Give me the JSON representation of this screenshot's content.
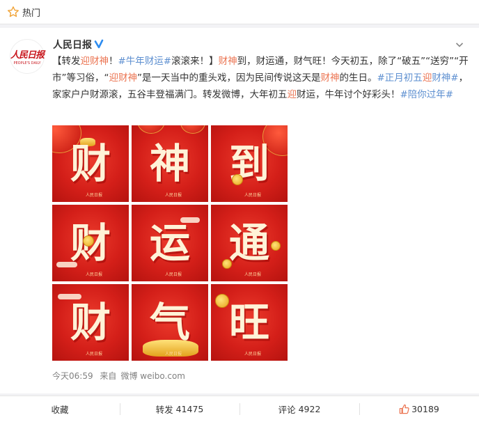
{
  "topbar": {
    "label": "热门",
    "icon": "star-icon"
  },
  "post": {
    "avatar": {
      "cn": "人民日报",
      "en": "PEOPLE'S DAILY"
    },
    "author": "人民日报",
    "verified_icon": "verified-icon",
    "text": {
      "p1": "【转发",
      "link1": "迎财神",
      "p2": "！",
      "tag1": "#牛年财运#",
      "p3": "滚滚来！】",
      "link2": "财神",
      "p4": "到，财运通，财气旺！今天初五，除了“破五”“送穷”“开市”等习俗，“",
      "link3": "迎财神",
      "p5": "”是一天当中的重头戏，因为民间传说这天是",
      "link4": "财神",
      "p6": "的生日。",
      "tag2a": "#正月初五",
      "link5": "迎",
      "tag2b": "财神#",
      "p7": "，家家户户财源滚，五谷丰登福满门。转发微博，大年初五",
      "link6": "迎",
      "p8": "财运，牛年讨个好彩头！",
      "tag3": "#陪你过年#"
    },
    "images": [
      {
        "char": "财",
        "logo": "人民日报"
      },
      {
        "char": "神",
        "logo": "人民日报"
      },
      {
        "char": "到",
        "logo": "人民日报"
      },
      {
        "char": "财",
        "logo": "人民日报"
      },
      {
        "char": "运",
        "logo": "人民日报"
      },
      {
        "char": "通",
        "logo": "人民日报"
      },
      {
        "char": "财",
        "logo": "人民日报"
      },
      {
        "char": "气",
        "logo": "人民日报"
      },
      {
        "char": "旺",
        "logo": "人民日报"
      }
    ],
    "meta": {
      "time": "今天06:59",
      "source_prefix": "来自",
      "source": "微博 weibo.com"
    }
  },
  "actions": {
    "favorite": "收藏",
    "repost_label": "转发",
    "repost_count": "41475",
    "comment_label": "评论",
    "comment_count": "4922",
    "like_count": "30189"
  },
  "colors": {
    "link": "#eb7350",
    "tag": "#5d8fd0",
    "accent_red": "#d41f19",
    "star": "#f0a030"
  }
}
